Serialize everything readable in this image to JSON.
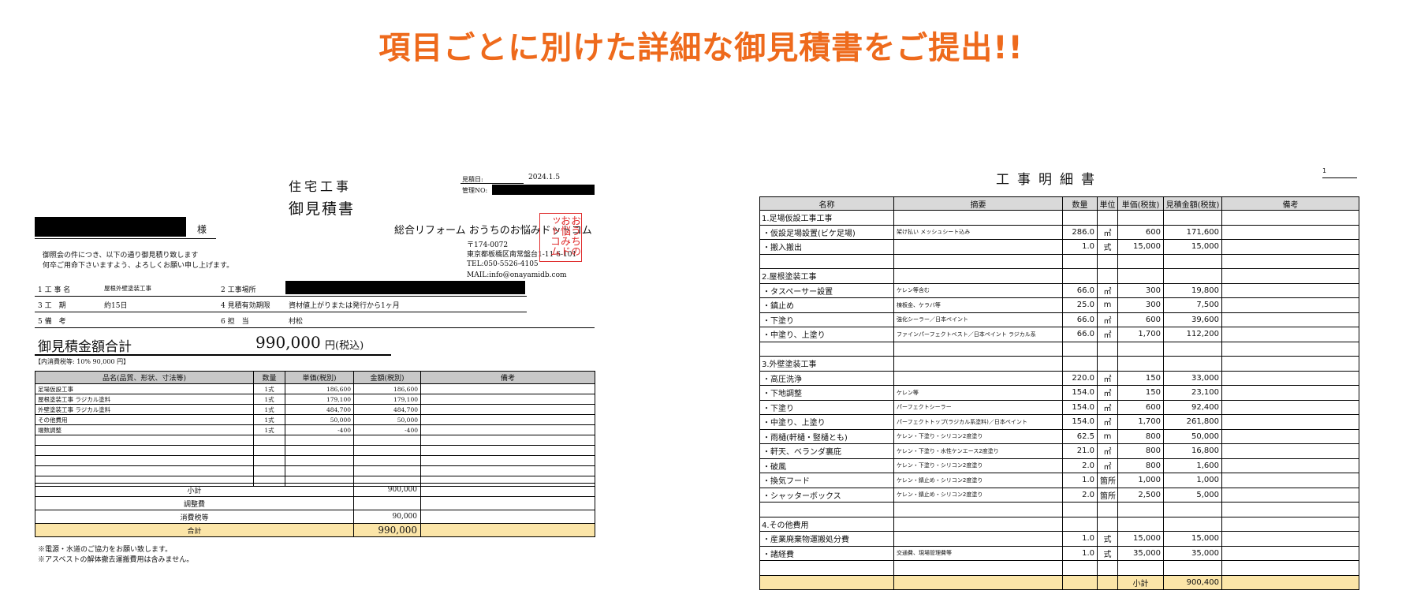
{
  "headline": "項目ごとに別けた詳細な御見積書をご提出!!",
  "estimate": {
    "subtitle": "住宅工事",
    "title": "御見積書",
    "date_label": "見積日:",
    "date": "2024.1.5",
    "control_label": "管理NO:",
    "sama": "様",
    "company": "総合リフォーム おうちのお悩みドットコム",
    "postal": "〒174-0072",
    "address": "東京都板橋区南常盤台1-11-6-101",
    "tel": "TEL:050-5526-4105",
    "mail": "MAIL:info@onayamidb.com",
    "greeting": [
      "御照会の件につき、以下の通り御見積り致します",
      "何卒ご用命下さいますよう、よろしくお願い申し上げます。"
    ],
    "stamp": "おうちのお悩みドットコム",
    "info": {
      "f1_label": "1 工 事 名",
      "f1_value": "屋根外壁塗装工事",
      "f2_label": "2 工事場所",
      "f3_label": "3 工　期",
      "f3_value": "約15日",
      "f4_label": "4 見積有効期限",
      "f4_value": "資材値上がりまたは発行から1ヶ月",
      "f5_label": "5 備　考",
      "f6_label": "6 担　当",
      "f6_value": "村松"
    },
    "total_label": "御見積金額合計",
    "total_value": "990,000",
    "total_unit": "円(税込)",
    "tax_line": "【内消費税等: 10% 90,000 円】",
    "columns": [
      "品名(品質、形状、寸法等)",
      "数量",
      "単価(税別)",
      "金額(税別)",
      "備考"
    ],
    "items": [
      {
        "name": "足場仮設工事",
        "qty": "1式",
        "unit": "186,600",
        "amount": "186,600"
      },
      {
        "name": "屋根塗装工事 ラジカル塗料",
        "qty": "1式",
        "unit": "179,100",
        "amount": "179,100"
      },
      {
        "name": "外壁塗装工事 ラジカル塗料",
        "qty": "1式",
        "unit": "484,700",
        "amount": "484,700"
      },
      {
        "name": "その他費用",
        "qty": "1式",
        "unit": "50,000",
        "amount": "50,000"
      },
      {
        "name": "端数調整",
        "qty": "1式",
        "unit": "-400",
        "amount": "-400"
      }
    ],
    "subtotal_label": "小計",
    "subtotal": "900,000",
    "adjust_label": "調整費",
    "tax_label": "消費税等",
    "tax": "90,000",
    "grand_label": "合計",
    "grand": "990,000",
    "notes": [
      "※電源・水道のご協力をお願い致します。",
      "※アスベストの解体撤去運搬費用は含みません。"
    ]
  },
  "detail": {
    "title": "工事明細書",
    "page": "1",
    "columns": [
      "名称",
      "摘要",
      "数量",
      "単位",
      "単価(税抜)",
      "見積金額(税抜)",
      "備考"
    ],
    "rows": [
      {
        "type": "sec",
        "name": "1.足場仮設工事工事"
      },
      {
        "name": "・仮設足場設置(ビケ足場)",
        "desc": "架け払い メッシュシート込み",
        "qty": "286.0",
        "unit": "㎡",
        "price": "600",
        "amount": "171,600"
      },
      {
        "name": "・搬入搬出",
        "desc": "",
        "qty": "1.0",
        "unit": "式",
        "price": "15,000",
        "amount": "15,000"
      },
      {
        "type": "blank"
      },
      {
        "type": "sec",
        "name": "2.屋根塗装工事"
      },
      {
        "name": "・タスペーサー設置",
        "desc": "ケレン等含む",
        "qty": "66.0",
        "unit": "㎡",
        "price": "300",
        "amount": "19,800"
      },
      {
        "name": "・鎮止め",
        "desc": "棟板金、ケラバ等",
        "qty": "25.0",
        "unit": "m",
        "price": "300",
        "amount": "7,500"
      },
      {
        "name": "・下塗り",
        "desc": "強化シーラー／日本ペイント",
        "qty": "66.0",
        "unit": "㎡",
        "price": "600",
        "amount": "39,600"
      },
      {
        "name": "・中塗り、上塗り",
        "desc": "ファインパーフェクトベスト／日本ペイント ラジカル系",
        "qty": "66.0",
        "unit": "㎡",
        "price": "1,700",
        "amount": "112,200"
      },
      {
        "type": "blank"
      },
      {
        "type": "sec",
        "name": "3.外壁塗装工事"
      },
      {
        "name": "・高圧洗浄",
        "desc": "",
        "qty": "220.0",
        "unit": "㎡",
        "price": "150",
        "amount": "33,000"
      },
      {
        "name": "・下地調整",
        "desc": "ケレン等",
        "qty": "154.0",
        "unit": "㎡",
        "price": "150",
        "amount": "23,100"
      },
      {
        "name": "・下塗り",
        "desc": "パーフェクトシーラー",
        "qty": "154.0",
        "unit": "㎡",
        "price": "600",
        "amount": "92,400"
      },
      {
        "name": "・中塗り、上塗り",
        "desc": "パーフェクトトップ(ラジカル系塗料)／日本ペイント",
        "qty": "154.0",
        "unit": "㎡",
        "price": "1,700",
        "amount": "261,800"
      },
      {
        "name": "・雨樋(軒樋・竪樋とも)",
        "desc": "ケレン・下塗り・シリコン2度塗り",
        "qty": "62.5",
        "unit": "m",
        "price": "800",
        "amount": "50,000"
      },
      {
        "name": "・軒天、ベランダ裏庇",
        "desc": "ケレン・下塗り・水性ケンエース2度塗り",
        "qty": "21.0",
        "unit": "㎡",
        "price": "800",
        "amount": "16,800"
      },
      {
        "name": "・破風",
        "desc": "ケレン・下塗り・シリコン2度塗り",
        "qty": "2.0",
        "unit": "㎡",
        "price": "800",
        "amount": "1,600"
      },
      {
        "name": "・換気フード",
        "desc": "ケレン・錆止め・シリコン2度塗り",
        "qty": "1.0",
        "unit": "箇所",
        "price": "1,000",
        "amount": "1,000"
      },
      {
        "name": "・シャッターボックス",
        "desc": "ケレン・錆止め・シリコン2度塗り",
        "qty": "2.0",
        "unit": "箇所",
        "price": "2,500",
        "amount": "5,000"
      },
      {
        "type": "blank"
      },
      {
        "type": "sec",
        "name": "4.その他費用"
      },
      {
        "name": "・産業廃棄物運搬処分費",
        "desc": "",
        "qty": "1.0",
        "unit": "式",
        "price": "15,000",
        "amount": "15,000"
      },
      {
        "name": "・諸経費",
        "desc": "交通費、現場管理費等",
        "qty": "1.0",
        "unit": "式",
        "price": "35,000",
        "amount": "35,000"
      }
    ],
    "subtotal_label": "小計",
    "subtotal": "900,400"
  }
}
